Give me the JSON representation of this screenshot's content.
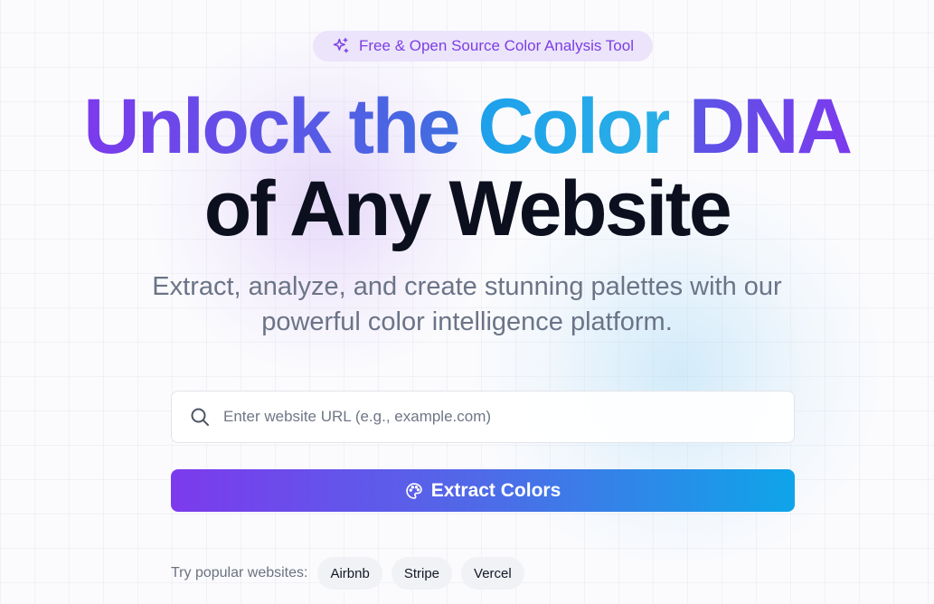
{
  "badge": {
    "icon": "sparkles-icon",
    "text": "Free & Open Source Color Analysis Tool"
  },
  "headline": {
    "line1_part1": "Unlock the",
    "line1_part2": "Color",
    "line1_part3": "DNA",
    "line2": "of Any Website"
  },
  "subtitle": {
    "line1": "Extract, analyze, and create stunning palettes with our",
    "line2": "powerful color intelligence platform."
  },
  "search": {
    "icon": "search-icon",
    "placeholder": "Enter website URL (e.g., example.com)",
    "value": ""
  },
  "extract_button": {
    "icon": "palette-icon",
    "label": "Extract Colors"
  },
  "popular": {
    "label": "Try popular websites:",
    "sites": [
      "Airbnb",
      "Stripe",
      "Vercel"
    ]
  },
  "colors": {
    "accent_purple": "#7c3aed",
    "accent_blue": "#0ea5e9",
    "badge_bg": "#ece4fb",
    "heading_dark": "#0b0f1e",
    "subtitle_gray": "#6b7487"
  }
}
